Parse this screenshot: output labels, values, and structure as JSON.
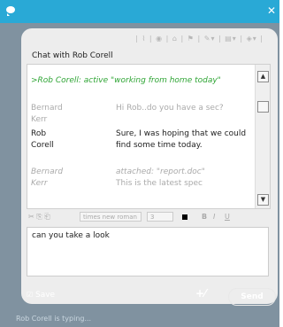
{
  "header": {
    "close_glyph": "✕",
    "chat_icon": "chat-bubble-icon"
  },
  "panel": {
    "format_icons": "| ⌇ | ◉ | ⌂ | ⚑ | ✎▾ | ▤▾ | ◈▾ |",
    "title": "Chat with Rob Corell"
  },
  "history": {
    "status": ">Rob Corell: active \"working from home today\"",
    "messages": [
      {
        "name": "Bernard Kerr",
        "text": "Hi Rob..do you have a sec?"
      },
      {
        "name": "Rob Corell",
        "text": "Sure, I was hoping that we could find some time today."
      },
      {
        "name": "Bernard Kerr",
        "text": "attached: \"report.doc\"",
        "extra": "This is the latest spec"
      }
    ]
  },
  "toolbar": {
    "icons": "✂ ⎘ ⎗",
    "font": "times new roman",
    "size": "3",
    "bold": "B",
    "italic": "I",
    "underline": "U"
  },
  "compose": {
    "value": "can you take a look"
  },
  "footer": {
    "save_label": "Save",
    "save_checked": "☑",
    "attach_label": "+⁄",
    "send_label": "Send",
    "typing": "Rob Corell is typing..."
  },
  "colors": {
    "titlebar": "#29a9d6",
    "frame": "#8092a0",
    "status": "#2fa535"
  }
}
